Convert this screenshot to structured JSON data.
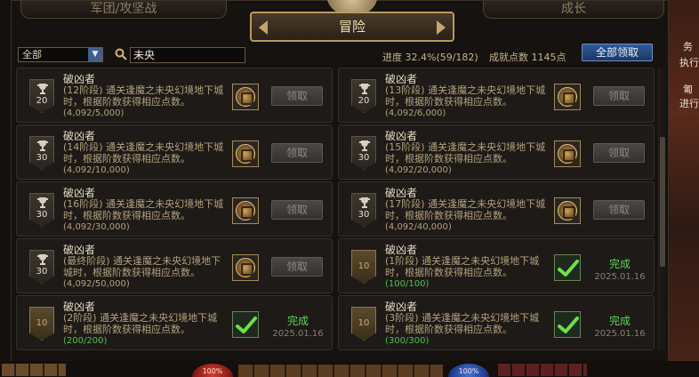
{
  "side_panel": {
    "line1": "务",
    "line2": "执行",
    "line3": "匍",
    "line4": "进行"
  },
  "tabs": {
    "left": "军团/攻坚战",
    "active": "冒险",
    "right": "成长"
  },
  "filter": {
    "category_value": "全部",
    "search_value": "未央"
  },
  "summary": {
    "progress": "进度 32.4%(59/182)",
    "points": "成就点数 1145点",
    "claim_all_label": "全部领取"
  },
  "achievements": [
    {
      "title": "破凶者",
      "description": "(12阶段) 通关逢魔之未央幻境地下城时，根据阶数获得相应点数。",
      "count": "(4,092/5,000)",
      "points": "20",
      "status": "locked",
      "button": "领取",
      "date": ""
    },
    {
      "title": "破凶者",
      "description": "(13阶段) 通关逢魔之未央幻境地下城时，根据阶数获得相应点数。",
      "count": "(4,092/6,000)",
      "points": "20",
      "status": "locked",
      "button": "领取",
      "date": ""
    },
    {
      "title": "破凶者",
      "description": "(14阶段) 通关逢魔之未央幻境地下城时，根据阶数获得相应点数。",
      "count": "(4,092/10,000)",
      "points": "30",
      "status": "locked",
      "button": "领取",
      "date": ""
    },
    {
      "title": "破凶者",
      "description": "(15阶段) 通关逢魔之未央幻境地下城时，根据阶数获得相应点数。",
      "count": "(4,092/20,000)",
      "points": "30",
      "status": "locked",
      "button": "领取",
      "date": ""
    },
    {
      "title": "破凶者",
      "description": "(16阶段) 通关逢魔之未央幻境地下城时，根据阶数获得相应点数。",
      "count": "(4,092/30,000)",
      "points": "30",
      "status": "locked",
      "button": "领取",
      "date": ""
    },
    {
      "title": "破凶者",
      "description": "(17阶段) 通关逢魔之未央幻境地下城时，根据阶数获得相应点数。",
      "count": "(4,092/40,000)",
      "points": "30",
      "status": "locked",
      "button": "领取",
      "date": ""
    },
    {
      "title": "破凶者",
      "description": "(最终阶段) 通关逢魔之未央幻境地下城时，根据阶数获得相应点数。",
      "count": "(4,092/50,000)",
      "points": "30",
      "status": "locked",
      "button": "领取",
      "date": ""
    },
    {
      "title": "破凶者",
      "description": "(1阶段) 通关逢魔之未央幻境地下城时，根据阶数获得相应点数。",
      "count": "(100/100)",
      "points": "10",
      "status": "done",
      "button": "完成",
      "date": "2025.01.16"
    },
    {
      "title": "破凶者",
      "description": "(2阶段) 通关逢魔之未央幻境地下城时，根据阶数获得相应点数。",
      "count": "(200/200)",
      "points": "10",
      "status": "done",
      "button": "完成",
      "date": "2025.01.16"
    },
    {
      "title": "破凶者",
      "description": "(3阶段) 通关逢魔之未央幻境地下城时，根据阶数获得相应点数。",
      "count": "(300/300)",
      "points": "10",
      "status": "done",
      "button": "完成",
      "date": "2025.01.16"
    }
  ],
  "hud": {
    "hp": "100%",
    "mp": "100%"
  }
}
